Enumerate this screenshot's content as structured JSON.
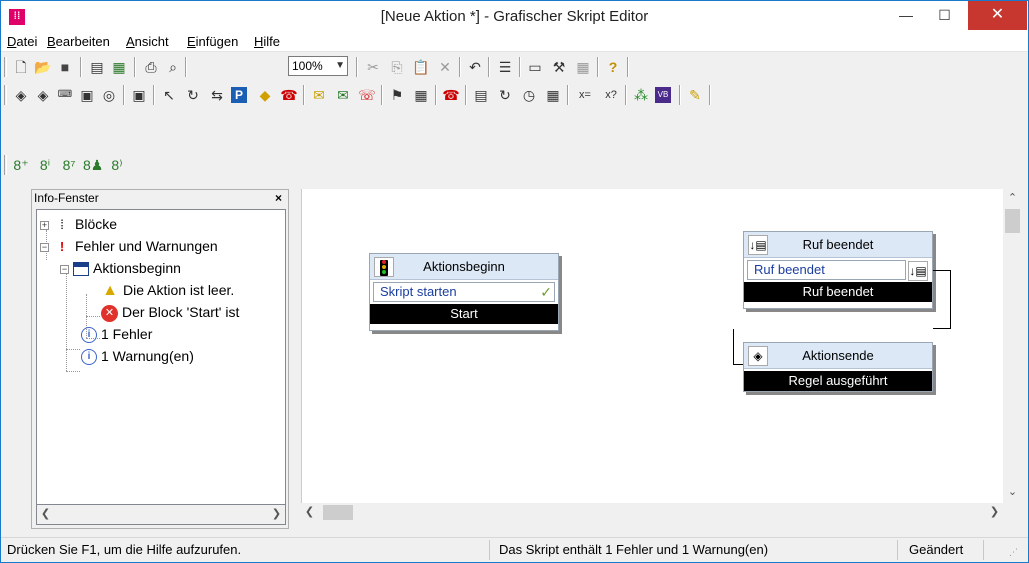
{
  "window": {
    "title": "[Neue Aktion *] - Grafischer Skript Editor",
    "app_icon": "script-editor-icon",
    "minimize_icon": "minimize-icon",
    "maximize_icon": "maximize-icon",
    "close_icon": "close-icon",
    "close_color": "#c7372f"
  },
  "menu": {
    "items": [
      {
        "label": "Datei",
        "key": "D"
      },
      {
        "label": "Bearbeiten",
        "key": "B"
      },
      {
        "label": "Ansicht",
        "key": "A"
      },
      {
        "label": "Einfügen",
        "key": "E"
      },
      {
        "label": "Hilfe",
        "key": "H"
      }
    ]
  },
  "toolbar1": {
    "icons": [
      "new-icon",
      "open-icon",
      "save-icon",
      "properties-icon",
      "sort-icon",
      "print-icon",
      "print-preview-icon"
    ],
    "zoom_value": "100%",
    "icons_after_zoom": [
      "cut-icon",
      "copy-icon",
      "paste-icon",
      "delete-icon",
      "undo-icon",
      "list-icon",
      "block-icon",
      "variables-icon",
      "grid-icon",
      "help-icon"
    ]
  },
  "toolbar2": {
    "icons": [
      "start-action-icon",
      "end-action-icon",
      "keypad-123-icon",
      "keypad-icon",
      "voicemail-icon",
      "recorder-icon",
      "call-forward-icon",
      "call-transfer-icon",
      "call-pickup-icon",
      "parking-icon",
      "decision-icon",
      "call-list-icon",
      "email-icon",
      "email-send-icon",
      "phone-handset-icon",
      "date-icon",
      "calendar-icon",
      "hangup-icon",
      "caller-id-icon",
      "call-queue-icon",
      "clock-icon",
      "schedule-icon",
      "set-variable-icon",
      "query-variable-icon",
      "script-icon",
      "vb-icon",
      "notepad-icon"
    ]
  },
  "toolbar3": {
    "icons": [
      "block-add-icon",
      "block-info-icon",
      "block-edit-icon",
      "block-user-icon",
      "block-group-icon"
    ]
  },
  "info_panel": {
    "title": "Info-Fenster",
    "close_label": "×",
    "tree": [
      {
        "label": "Blöcke",
        "icon": "blocks-icon",
        "toggle": "+"
      },
      {
        "label": "Fehler und Warnungen",
        "icon": "error-mark-icon",
        "toggle": "−"
      },
      {
        "label": "Aktionsbeginn",
        "icon": "table-icon",
        "toggle": "−"
      },
      {
        "label": "Die Aktion ist leer.",
        "icon": "warning-icon"
      },
      {
        "label": "Der Block 'Start' ist",
        "icon": "error-icon"
      },
      {
        "label": "1 Fehler",
        "icon": "info-icon"
      },
      {
        "label": "1 Warnung(en)",
        "icon": "info-icon"
      }
    ]
  },
  "blocks": {
    "aktionsbeginn": {
      "title": "Aktionsbeginn",
      "icon": "traffic-light-icon",
      "row": "Skript starten",
      "row_icon": "checkmark-icon",
      "footer": "Start"
    },
    "ruf_beendet": {
      "title": "Ruf beendet",
      "icon": "call-ended-icon",
      "row": "Ruf beendet",
      "row_icon": "call-ended-icon",
      "footer": "Ruf beendet"
    },
    "aktionsende": {
      "title": "Aktionsende",
      "icon": "end-action-icon",
      "footer": "Regel ausgeführt"
    }
  },
  "statusbar": {
    "help": "Drücken Sie F1, um die Hilfe aufzurufen.",
    "message": "Das Skript enthält 1 Fehler und 1 Warnung(en)",
    "state": "Geändert"
  },
  "colors": {
    "block_header": "#dce8f5",
    "block_footer": "#000000",
    "row_text": "#1a3ea0",
    "window_border": "#1979ca"
  }
}
